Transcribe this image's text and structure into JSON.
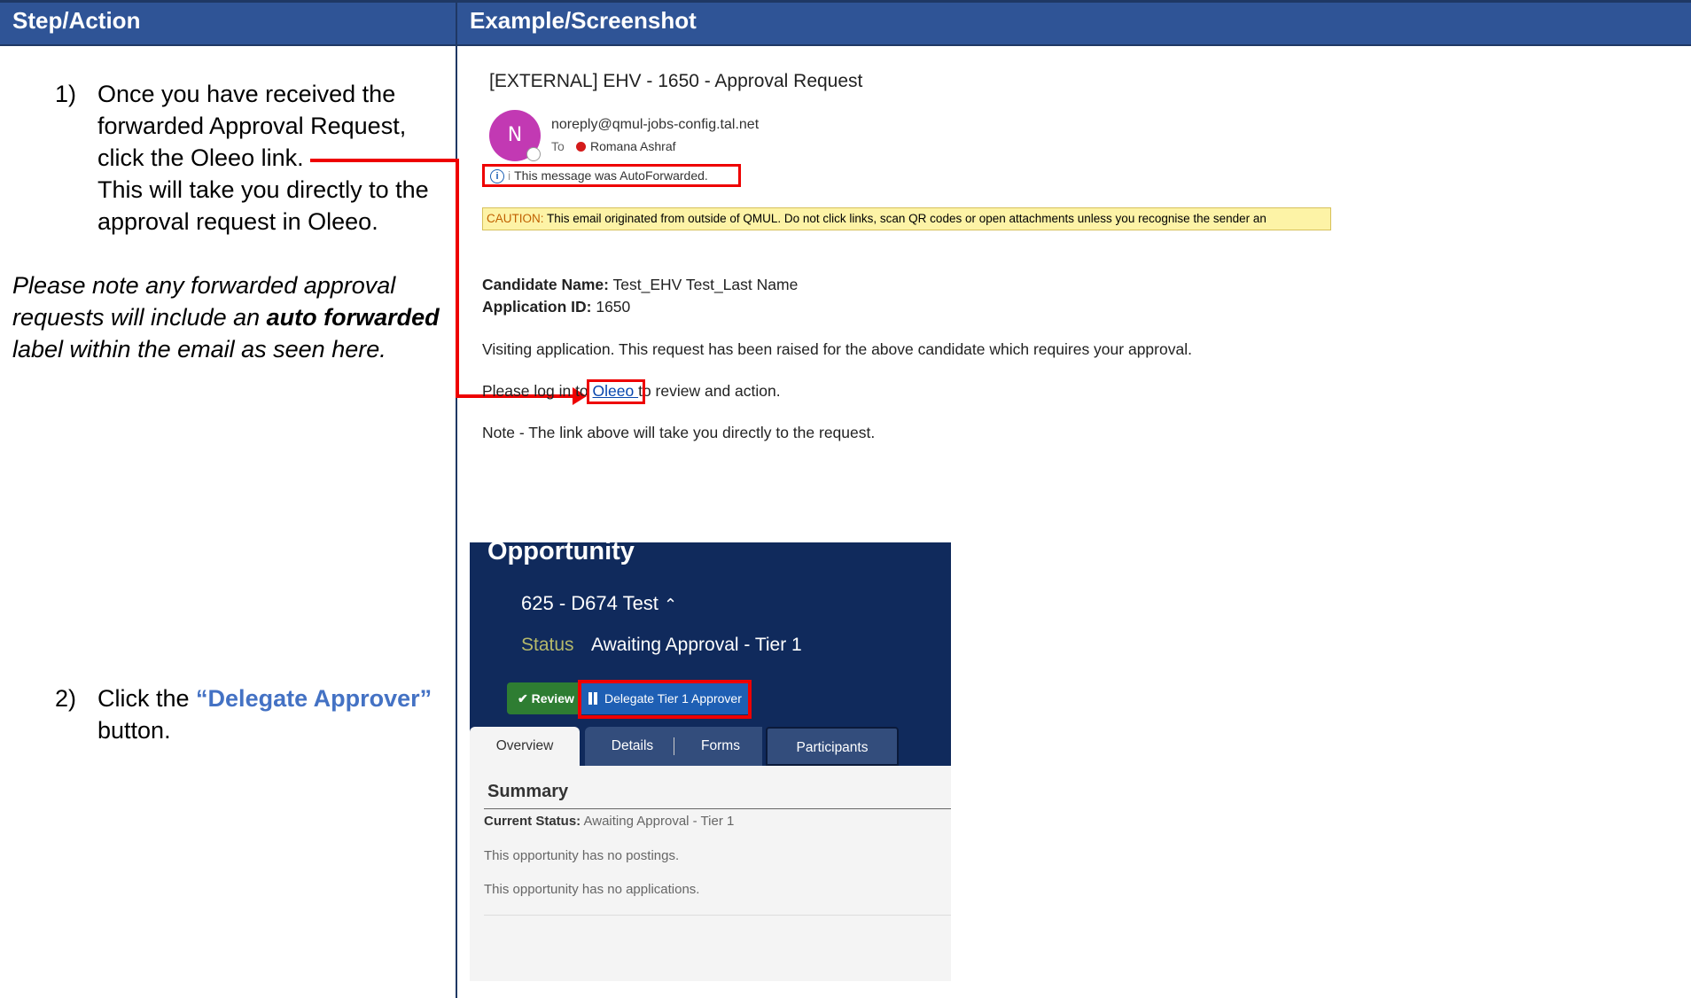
{
  "header": {
    "col1": "Step/Action",
    "col2": "Example/Screenshot"
  },
  "steps": {
    "s1_num": "1)",
    "s1_lines": [
      "Once you have received the",
      "forwarded Approval Request,",
      "click the Oleeo link.",
      "This will take you directly to the",
      "approval request in Oleeo."
    ],
    "note_pre": "Please note any forwarded approval requests will include an ",
    "note_bold": "auto forwarded",
    "note_post": " label within the email as seen here.",
    "s2_num": "2)",
    "s2_pre": "Click the ",
    "s2_quote": "“Delegate Approver”",
    "s2_post": "button."
  },
  "email": {
    "subject": "[EXTERNAL] EHV - 1650 - Approval Request",
    "avatar": "N",
    "sender": "noreply@qmul-jobs-config.tal.net",
    "to_label": "To",
    "to_name": "Romana Ashraf",
    "autofwd_prefix": "i",
    "autofwd": "This message was AutoForwarded.",
    "caution_label": "CAUTION:",
    "caution_text": " This email originated from outside of QMUL. Do not click links, scan QR codes or open attachments unless you recognise the sender an",
    "candidate_label": "Candidate Name:",
    "candidate_value": " Test_EHV Test_Last Name",
    "appid_label": "Application ID:",
    "appid_value": " 1650",
    "visiting": "Visiting application. This request has been raised for the above candidate which requires your approval.",
    "login_pre": "Please log in to ",
    "login_link": "Oleeo ",
    "login_post": "to review and action.",
    "note": "Note - The link above will take you directly to the request."
  },
  "oleeo": {
    "title": "Opportunity",
    "id": "625 - D674 Test",
    "status_label": "Status",
    "status_value": "Awaiting Approval - Tier 1",
    "review": "Review",
    "delegate": "Delegate Tier 1 Approver",
    "tabs": [
      "Overview",
      "Details",
      "Forms",
      "Participants"
    ],
    "summary": "Summary",
    "current_status_label": "Current Status:",
    "current_status_value": " Awaiting Approval - Tier 1",
    "no_postings": "This opportunity has no postings.",
    "no_applications": "This opportunity has no applications."
  },
  "colors": {
    "header": "#2f5496",
    "highlight": "#e00000",
    "link": "#0645ad",
    "step_accent": "#4472c4"
  }
}
